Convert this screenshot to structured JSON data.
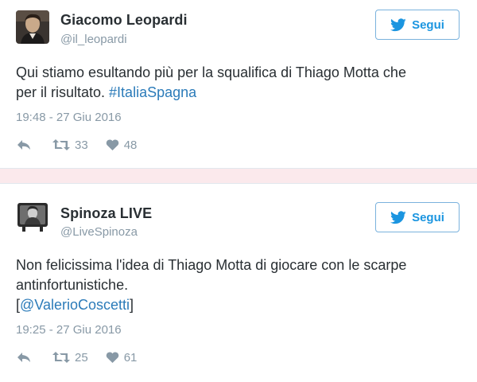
{
  "tweets": [
    {
      "display_name": "Giacomo Leopardi",
      "handle": "@il_leopardi",
      "follow_label": "Segui",
      "text_line1": "Qui stiamo esultando più per la squalifica di Thiago Motta che",
      "text_line2_plain": "per il risultato. ",
      "hashtag": "#ItaliaSpagna",
      "timestamp": "19:48 - 27 Giu 2016",
      "retweets": "33",
      "likes": "48"
    },
    {
      "display_name": "Spinoza LIVE",
      "handle": "@LiveSpinoza",
      "follow_label": "Segui",
      "text_line1": "Non felicissima l'idea di Thiago Motta di giocare con le scarpe",
      "text_line2": "antinfortunistiche.",
      "bracket_open": "[",
      "mention": "@ValerioCoscetti",
      "bracket_close": "]",
      "timestamp": "19:25 - 27 Giu 2016",
      "retweets": "25",
      "likes": "61"
    }
  ],
  "colors": {
    "link": "#2b7bb9",
    "follow_text": "#1b95e0",
    "secondary_text": "#8899a6",
    "separator": "#fbe9ec"
  },
  "icons": [
    "twitter-bird-icon",
    "reply-icon",
    "retweet-icon",
    "heart-icon"
  ]
}
